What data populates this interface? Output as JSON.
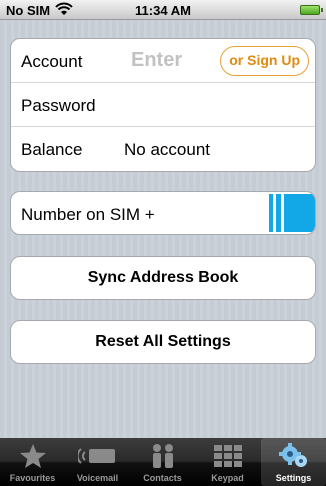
{
  "status": {
    "carrier": "No SIM",
    "time": "11:34 AM"
  },
  "account": {
    "label": "Account",
    "placeholder": "Enter",
    "signup": "or Sign Up"
  },
  "password": {
    "label": "Password"
  },
  "balance": {
    "label": "Balance",
    "value": "No account"
  },
  "sim": {
    "label": "Number on SIM +"
  },
  "buttons": {
    "sync": "Sync Address Book",
    "reset": "Reset All Settings"
  },
  "tabs": [
    {
      "label": "Favourites",
      "icon": "star-icon"
    },
    {
      "label": "Voicemail",
      "icon": "voicemail-icon"
    },
    {
      "label": "Contacts",
      "icon": "contacts-icon"
    },
    {
      "label": "Keypad",
      "icon": "keypad-icon"
    },
    {
      "label": "Settings",
      "icon": "settings-gear-icon"
    }
  ],
  "colors": {
    "accent": "#12a8e8",
    "signup": "#e08a10"
  }
}
